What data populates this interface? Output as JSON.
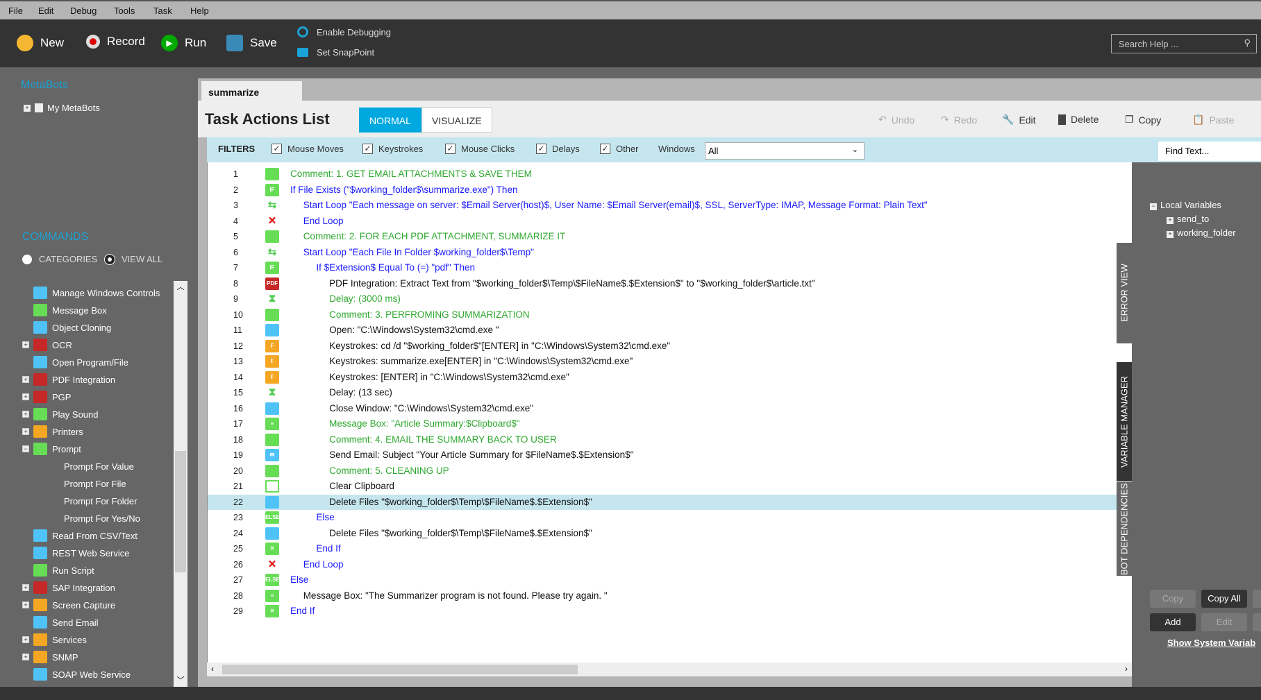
{
  "menu": [
    "File",
    "Edit",
    "Debug",
    "Tools",
    "Task",
    "Help"
  ],
  "toolbar": {
    "new": "New",
    "record": "Record",
    "run": "Run",
    "save": "Save",
    "debug": "Enable Debugging",
    "snap": "Set SnapPoint",
    "search_placeholder": "Search Help ..."
  },
  "sidebar": {
    "metabots": "MetaBots",
    "my_metabots": "My MetaBots",
    "commands": "COMMANDS",
    "categories": "CATEGORIES",
    "view_all": "VIEW ALL",
    "items": [
      {
        "label": "Manage Windows Controls",
        "exp": "",
        "icon": "#4fc3f7",
        "lvl": 0
      },
      {
        "label": "Message Box",
        "exp": "",
        "icon": "#66dd55",
        "lvl": 0
      },
      {
        "label": "Object Cloning",
        "exp": "",
        "icon": "#4fc3f7",
        "lvl": 0
      },
      {
        "label": "OCR",
        "exp": "+",
        "icon": "#c62828",
        "lvl": 0
      },
      {
        "label": "Open Program/File",
        "exp": "",
        "icon": "#4fc3f7",
        "lvl": 0
      },
      {
        "label": "PDF Integration",
        "exp": "+",
        "icon": "#c62828",
        "lvl": 0
      },
      {
        "label": "PGP",
        "exp": "+",
        "icon": "#c62828",
        "lvl": 0
      },
      {
        "label": "Play Sound",
        "exp": "+",
        "icon": "#66dd55",
        "lvl": 0
      },
      {
        "label": "Printers",
        "exp": "+",
        "icon": "#f5a623",
        "lvl": 0
      },
      {
        "label": "Prompt",
        "exp": "−",
        "icon": "#66dd55",
        "lvl": 0
      },
      {
        "label": "Prompt For Value",
        "exp": "",
        "icon": "",
        "lvl": 1
      },
      {
        "label": "Prompt For File",
        "exp": "",
        "icon": "",
        "lvl": 1
      },
      {
        "label": "Prompt For Folder",
        "exp": "",
        "icon": "",
        "lvl": 1
      },
      {
        "label": "Prompt For Yes/No",
        "exp": "",
        "icon": "",
        "lvl": 1
      },
      {
        "label": "Read From CSV/Text",
        "exp": "",
        "icon": "#4fc3f7",
        "lvl": 0
      },
      {
        "label": "REST Web Service",
        "exp": "",
        "icon": "#4fc3f7",
        "lvl": 0
      },
      {
        "label": "Run Script",
        "exp": "",
        "icon": "#66dd55",
        "lvl": 0
      },
      {
        "label": "SAP Integration",
        "exp": "+",
        "icon": "#c62828",
        "lvl": 0
      },
      {
        "label": "Screen Capture",
        "exp": "+",
        "icon": "#f5a623",
        "lvl": 0
      },
      {
        "label": "Send Email",
        "exp": "",
        "icon": "#4fc3f7",
        "lvl": 0
      },
      {
        "label": "Services",
        "exp": "+",
        "icon": "#f5a623",
        "lvl": 0
      },
      {
        "label": "SNMP",
        "exp": "+",
        "icon": "#f5a623",
        "lvl": 0
      },
      {
        "label": "SOAP Web Service",
        "exp": "",
        "icon": "#4fc3f7",
        "lvl": 0
      }
    ]
  },
  "tab": "summarize",
  "header": {
    "title": "Task Actions List",
    "normal": "NORMAL",
    "visualize": "VISUALIZE",
    "undo": "Undo",
    "redo": "Redo",
    "edit": "Edit",
    "delete": "Delete",
    "copy": "Copy",
    "paste": "Paste"
  },
  "filters": {
    "label": "FILTERS",
    "mouse_moves": "Mouse Moves",
    "keystrokes": "Keystrokes",
    "mouse_clicks": "Mouse Clicks",
    "delays": "Delays",
    "other": "Other",
    "windows": "Windows",
    "windows_value": "All",
    "find": "Find Text..."
  },
  "colors": {
    "comment": "#2ea82e",
    "blue": "#1a1aff",
    "black": "#111111",
    "accent": "#00a8e0"
  },
  "lines": [
    {
      "n": "1",
      "i": 0,
      "c": "comment",
      "ic": "comment",
      "t": "Comment: 1. GET EMAIL ATTACHMENTS & SAVE THEM"
    },
    {
      "n": "2",
      "i": 0,
      "c": "blue",
      "ic": "if",
      "t": "If File Exists (\"$working_folder$\\summarize.exe\")  Then"
    },
    {
      "n": "3",
      "i": 1,
      "c": "blue",
      "ic": "loop",
      "t": "Start Loop \"Each  message on server: $Email Server(host)$, User Name: $Email Server(email)$, SSL,  ServerType: IMAP, Message Format: Plain Text\""
    },
    {
      "n": "4",
      "i": 1,
      "c": "blue",
      "ic": "endloop",
      "t": "End Loop"
    },
    {
      "n": "5",
      "i": 1,
      "c": "comment",
      "ic": "comment",
      "t": "Comment: 2. FOR EACH PDF ATTACHMENT, SUMMARIZE IT"
    },
    {
      "n": "6",
      "i": 1,
      "c": "blue",
      "ic": "loop",
      "t": "Start Loop \"Each File In Folder $working_folder$\\Temp\""
    },
    {
      "n": "7",
      "i": 2,
      "c": "blue",
      "ic": "if",
      "t": "If $Extension$ Equal To (=) \"pdf\" Then"
    },
    {
      "n": "8",
      "i": 3,
      "c": "black",
      "ic": "pdf",
      "t": "PDF Integration: Extract Text from \"$working_folder$\\Temp\\$FileName$.$Extension$\" to \"$working_folder$\\article.txt\""
    },
    {
      "n": "9",
      "i": 3,
      "c": "comment",
      "ic": "delay",
      "t": "Delay: (3000 ms)"
    },
    {
      "n": "10",
      "i": 3,
      "c": "comment",
      "ic": "comment",
      "t": "Comment: 3. PERFROMING SUMMARIZATION"
    },
    {
      "n": "11",
      "i": 3,
      "c": "black",
      "ic": "open",
      "t": "Open: \"C:\\Windows\\System32\\cmd.exe \""
    },
    {
      "n": "12",
      "i": 3,
      "c": "black",
      "ic": "keys",
      "t": "Keystrokes: cd /d \"$working_folder$\"[ENTER] in \"C:\\Windows\\System32\\cmd.exe\""
    },
    {
      "n": "13",
      "i": 3,
      "c": "black",
      "ic": "keys",
      "t": "Keystrokes: summarize.exe[ENTER] in \"C:\\Windows\\System32\\cmd.exe\""
    },
    {
      "n": "14",
      "i": 3,
      "c": "black",
      "ic": "keys",
      "t": "Keystrokes: [ENTER] in \"C:\\Windows\\System32\\cmd.exe\""
    },
    {
      "n": "15",
      "i": 3,
      "c": "black",
      "ic": "delay",
      "t": "Delay: (13 sec)"
    },
    {
      "n": "16",
      "i": 3,
      "c": "black",
      "ic": "close",
      "t": "Close Window: \"C:\\Windows\\System32\\cmd.exe\""
    },
    {
      "n": "17",
      "i": 3,
      "c": "comment",
      "ic": "msg",
      "t": "Message Box: \"Article Summary:$Clipboard$\""
    },
    {
      "n": "18",
      "i": 3,
      "c": "comment",
      "ic": "comment",
      "t": "Comment: 4. EMAIL THE SUMMARY BACK TO USER"
    },
    {
      "n": "19",
      "i": 3,
      "c": "black",
      "ic": "email",
      "t": "Send Email: Subject \"Your Article Summary for $FileName$.$Extension$\""
    },
    {
      "n": "20",
      "i": 3,
      "c": "comment",
      "ic": "comment",
      "t": "Comment: 5. CLEANING UP"
    },
    {
      "n": "21",
      "i": 3,
      "c": "black",
      "ic": "clip",
      "t": "Clear Clipboard"
    },
    {
      "n": "22",
      "i": 3,
      "c": "black",
      "ic": "folder",
      "t": "Delete Files \"$working_folder$\\Temp\\$FileName$.$Extension$\"",
      "sel": true
    },
    {
      "n": "23",
      "i": 2,
      "c": "blue",
      "ic": "else",
      "t": "Else"
    },
    {
      "n": "24",
      "i": 3,
      "c": "black",
      "ic": "folder",
      "t": "Delete Files \"$working_folder$\\Temp\\$FileName$.$Extension$\""
    },
    {
      "n": "25",
      "i": 2,
      "c": "blue",
      "ic": "endif",
      "t": "End If"
    },
    {
      "n": "26",
      "i": 1,
      "c": "blue",
      "ic": "endloop",
      "t": "End Loop"
    },
    {
      "n": "27",
      "i": 0,
      "c": "blue",
      "ic": "else",
      "t": "Else"
    },
    {
      "n": "28",
      "i": 1,
      "c": "black",
      "ic": "msg",
      "t": "Message Box: \"The Summarizer program is not found. Please try again. \""
    },
    {
      "n": "29",
      "i": 0,
      "c": "blue",
      "ic": "endif",
      "t": "End If"
    }
  ],
  "right": {
    "error_view": "ERROR VIEW",
    "variable_manager": "VARIABLE MANAGER",
    "bot_dependencies": "BOT DEPENDENCIES",
    "local_vars": "Local Variables",
    "vars": [
      "send_to",
      "working_folder"
    ],
    "copy": "Copy",
    "copy_all": "Copy All",
    "add": "Add",
    "edit": "Edit",
    "show_system": "Show System Variab"
  }
}
